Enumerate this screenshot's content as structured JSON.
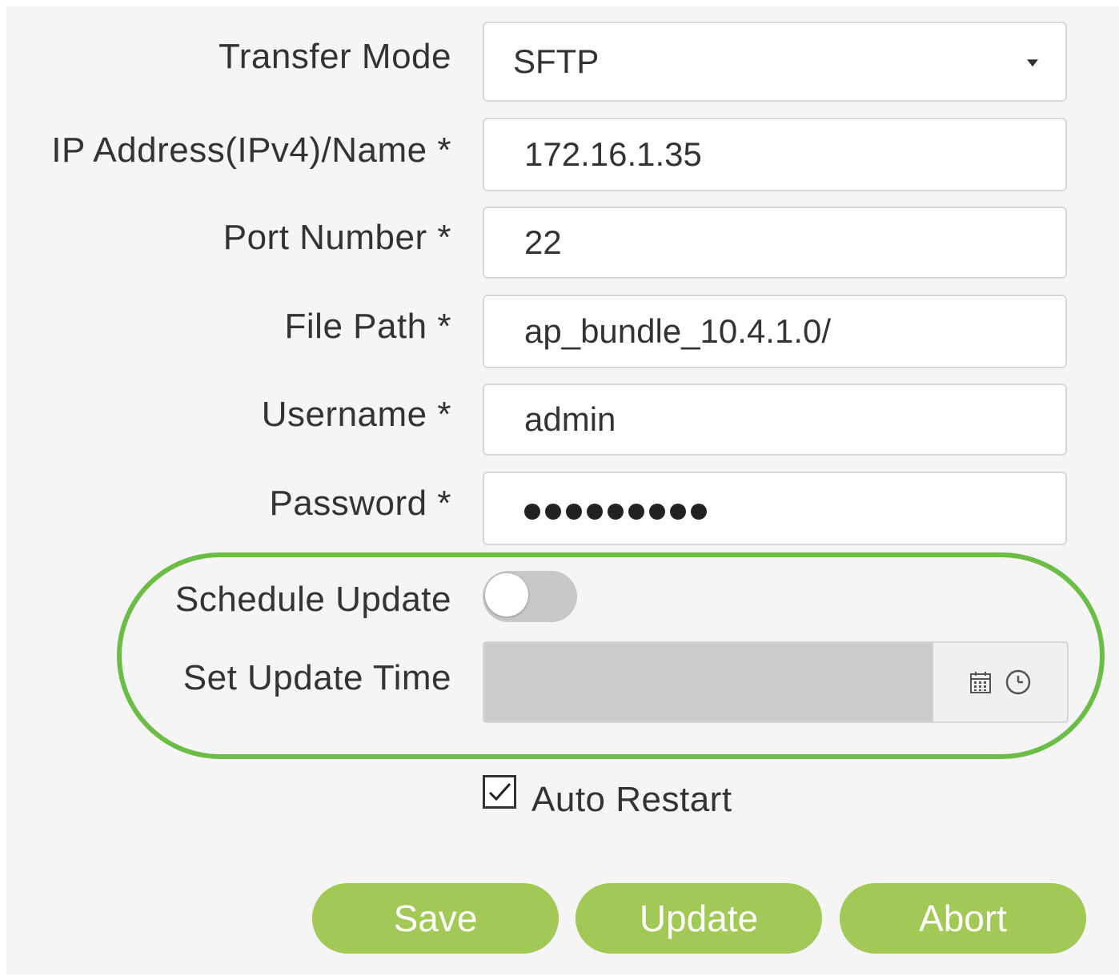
{
  "form": {
    "transfer_mode": {
      "label": "Transfer Mode",
      "value": "SFTP"
    },
    "ip_address": {
      "label": "IP Address(IPv4)/Name *",
      "value": "172.16.1.35"
    },
    "port_number": {
      "label": "Port Number *",
      "value": "22"
    },
    "file_path": {
      "label": "File Path *",
      "value": "ap_bundle_10.4.1.0/"
    },
    "username": {
      "label": "Username *",
      "value": "admin"
    },
    "password": {
      "label": "Password *",
      "masked_length": 9
    },
    "schedule_update": {
      "label": "Schedule Update",
      "enabled": false
    },
    "set_update_time": {
      "label": "Set Update Time",
      "value": ""
    },
    "auto_restart": {
      "label": "Auto Restart",
      "checked": true
    }
  },
  "buttons": {
    "save": "Save",
    "update": "Update",
    "abort": "Abort"
  },
  "colors": {
    "highlight": "#6cbd45",
    "button": "#a2c856",
    "disabled_field": "#cccccc"
  },
  "icons": [
    "calendar-icon",
    "clock-icon",
    "checkmark-icon",
    "caret-down-icon"
  ]
}
